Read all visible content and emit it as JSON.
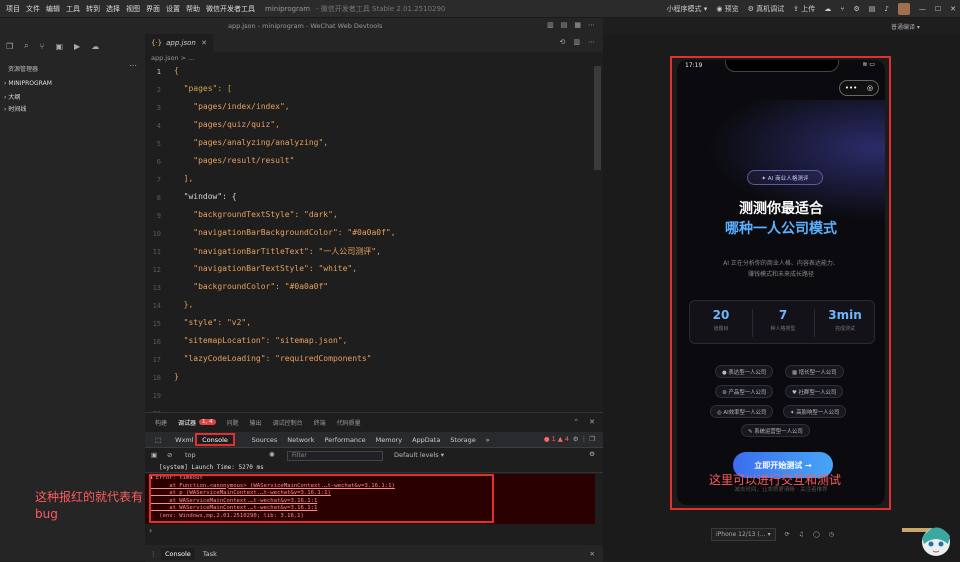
{
  "menubar": {
    "items": [
      "项目",
      "文件",
      "编辑",
      "工具",
      "转到",
      "选择",
      "视图",
      "界面",
      "设置",
      "帮助",
      "微信开发者工具"
    ],
    "title": "miniprogram",
    "subtitle": "- 微信开发者工具 Stable 2.01.2510290",
    "right": [
      "小程序模式 ▾",
      "预览",
      "真机调试",
      "上传"
    ]
  },
  "pathbar": {
    "center": "app.json - miniprogram - WeChat Web Devtools"
  },
  "explorer": {
    "header": "资源管理器",
    "items": [
      "MINIPROGRAM",
      "大纲",
      "时间线"
    ]
  },
  "editor": {
    "tab": "app.json",
    "breadcrumb": "app.json > ...",
    "lines": [
      {
        "n": "1",
        "t": "{"
      },
      {
        "n": "2",
        "t": "  \"pages\": ["
      },
      {
        "n": "3",
        "t": "    \"pages/index/index\","
      },
      {
        "n": "4",
        "t": "    \"pages/quiz/quiz\","
      },
      {
        "n": "5",
        "t": "    \"pages/analyzing/analyzing\","
      },
      {
        "n": "6",
        "t": "    \"pages/result/result\""
      },
      {
        "n": "7",
        "t": "  ],"
      },
      {
        "n": "8",
        "t": "  \"window\": {"
      },
      {
        "n": "9",
        "t": "    \"backgroundTextStyle\": \"dark\","
      },
      {
        "n": "10",
        "t": "    \"navigationBarBackgroundColor\": \"#0a0a0f\","
      },
      {
        "n": "11",
        "t": "    \"navigationBarTitleText\": \"一人公司测评\","
      },
      {
        "n": "12",
        "t": "    \"navigationBarTextStyle\": \"white\","
      },
      {
        "n": "13",
        "t": "    \"backgroundColor\": \"#0a0a0f\""
      },
      {
        "n": "14",
        "t": "  },"
      },
      {
        "n": "15",
        "t": "  \"style\": \"v2\","
      },
      {
        "n": "16",
        "t": "  \"sitemapLocation\": \"sitemap.json\","
      },
      {
        "n": "17",
        "t": "  \"lazyCodeLoading\": \"requiredComponents\""
      },
      {
        "n": "18",
        "t": "}"
      },
      {
        "n": "19",
        "t": ""
      },
      {
        "n": "20",
        "t": ""
      }
    ]
  },
  "panel": {
    "tabs": [
      "构建",
      "调试器",
      "问题",
      "输出",
      "调试控制台",
      "终端",
      "代码质量"
    ],
    "badge": "1, 4",
    "devtabs": [
      "Wxml",
      "Console",
      "Sources",
      "Network",
      "Performance",
      "Memory",
      "AppData",
      "Storage",
      "»"
    ],
    "errcount": "● 1 ▲ 4",
    "context": "top",
    "filter": "Filter",
    "levels": "Default levels ▾",
    "system": "[system] Launch Time: 5270 ms",
    "error": [
      "● Error: timeout",
      "      at Function.<anonymous> (WAServiceMainContext.…t-wechat&v=3.16.1:1)",
      "      at p (WAServiceMainContext.…t-wechat&v=3.16.1:1)",
      "      at WAServiceMainContext.…t-wechat&v=3.16.1:1",
      "      at WAServiceMainContext.…t-wechat&v=3.16.1:1",
      "   (env: Windows,mp,2.01.2510290; lib: 3.16.1)"
    ],
    "bottom": [
      "Console",
      "Task"
    ]
  },
  "note_left": "这种报红的就代表有bug",
  "phone": {
    "time": "17:19",
    "badge": "✦ AI 商业人格测评",
    "h1": "测测你最适合",
    "h2": "哪种一人公司模式",
    "desc1": "AI 正在分析你的商业人格、内容表达能力、",
    "desc2": "赚钱模式和未来成长路径",
    "stats": [
      {
        "v": "20",
        "l": "道题目"
      },
      {
        "v": "7",
        "l": "种人格类型"
      },
      {
        "v": "3min",
        "l": "完成测试"
      }
    ],
    "tags": [
      "● 表达型一人公司",
      "▦ 增长型一人公司",
      "⚙ 产品型一人公司",
      "♥ 社群型一人公司",
      "◎ AI效率型一人公司",
      "✦ 高影响型一人公司",
      "✎ 系统运营型一人公司"
    ],
    "start": "立即开始测试 →",
    "tip": "减去时间，让本质更清晰 · 关注者推荐"
  },
  "note_right": "这里可以进行交互和测试",
  "device": {
    "label": "iPhone 12/13 (… ▾",
    "extra": "普通编译 ▾"
  },
  "colors": {
    "accent": "#5ab0ff",
    "alert": "#e03030"
  }
}
